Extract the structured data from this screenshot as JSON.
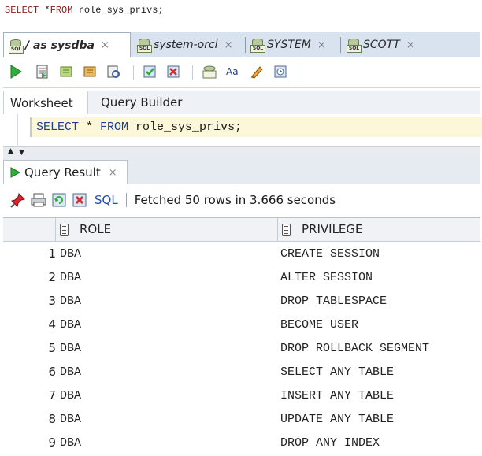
{
  "top_query": {
    "keyword1": "SELECT",
    "rest1": " *",
    "keyword2": "FROM",
    "rest2": " role_sys_privs;"
  },
  "connection_tabs": [
    {
      "label": "/ as sysdba",
      "close": "×"
    },
    {
      "label": "system-orcl",
      "close": "×"
    },
    {
      "label": "SYSTEM",
      "close": "×"
    },
    {
      "label": "SCOTT",
      "close": "×"
    }
  ],
  "icon_badge_text": "SQL",
  "worksheet_tabs": {
    "worksheet": "Worksheet",
    "query_builder": "Query Builder"
  },
  "editor": {
    "kw_select": "SELECT",
    "star": " * ",
    "kw_from": "FROM",
    "rest": " role_sys_privs;"
  },
  "result_tab": {
    "label": "Query Result",
    "close": "×"
  },
  "result_toolbar": {
    "sql_link": "SQL",
    "status": "Fetched 50 rows in 3.666 seconds"
  },
  "grid": {
    "headers": [
      "ROLE",
      "PRIVILEGE"
    ],
    "rows": [
      {
        "n": "1",
        "role": "DBA",
        "priv": "CREATE SESSION"
      },
      {
        "n": "2",
        "role": "DBA",
        "priv": "ALTER SESSION"
      },
      {
        "n": "3",
        "role": "DBA",
        "priv": "DROP TABLESPACE"
      },
      {
        "n": "4",
        "role": "DBA",
        "priv": "BECOME USER"
      },
      {
        "n": "5",
        "role": "DBA",
        "priv": "DROP ROLLBACK SEGMENT"
      },
      {
        "n": "6",
        "role": "DBA",
        "priv": "SELECT ANY TABLE"
      },
      {
        "n": "7",
        "role": "DBA",
        "priv": "INSERT ANY TABLE"
      },
      {
        "n": "8",
        "role": "DBA",
        "priv": "UPDATE ANY TABLE"
      },
      {
        "n": "9",
        "role": "DBA",
        "priv": "DROP ANY INDEX"
      }
    ]
  },
  "colors": {
    "keyword_red": "#8b1a1a",
    "keyword_blue": "#1c3f94",
    "link_blue": "#1d4fb8",
    "current_line": "#fbf7d8"
  }
}
